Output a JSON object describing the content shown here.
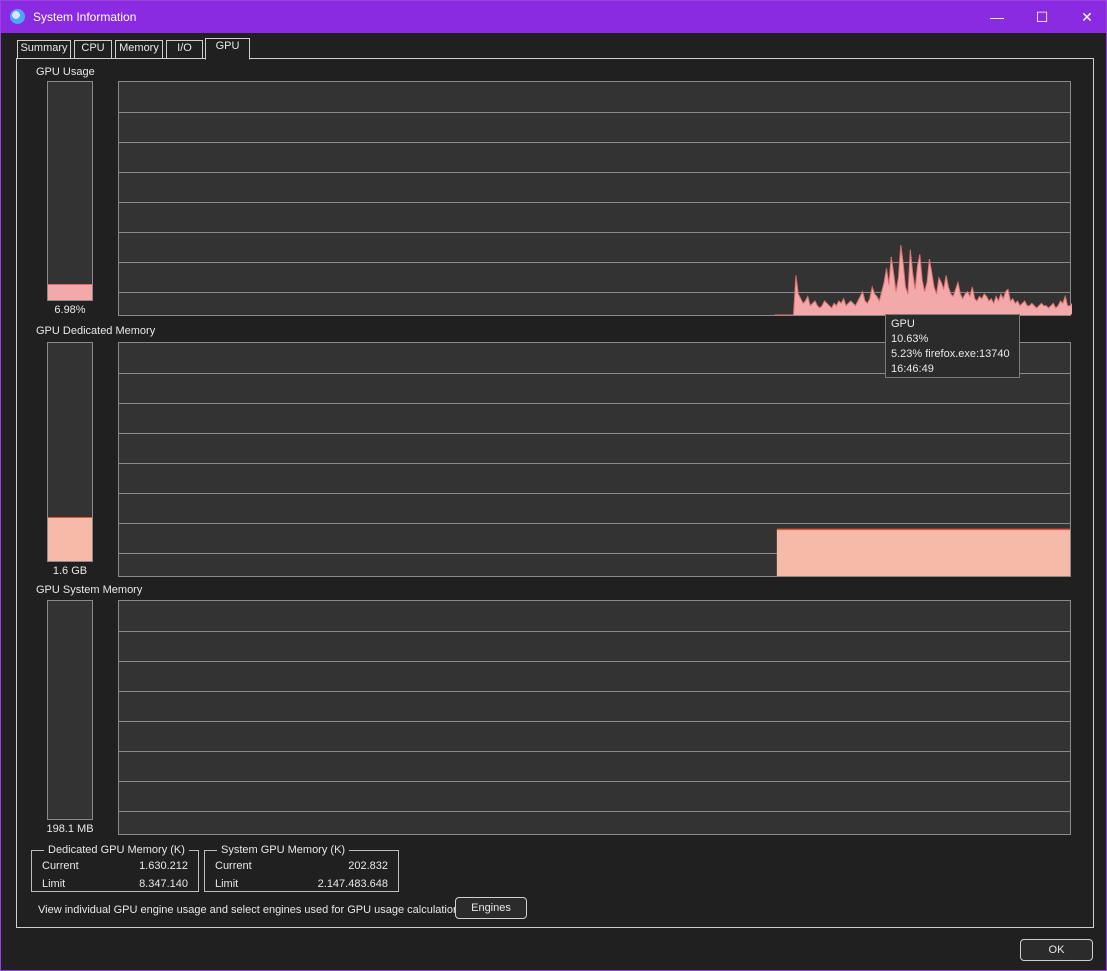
{
  "window": {
    "title": "System Information"
  },
  "tabs": [
    {
      "label": "Summary"
    },
    {
      "label": "CPU"
    },
    {
      "label": "Memory"
    },
    {
      "label": "I/O"
    },
    {
      "label": "GPU"
    }
  ],
  "sections": {
    "usage": {
      "label": "GPU Usage",
      "meter_value": "6.98%",
      "meter_fraction": 0.07
    },
    "dedicated": {
      "label": "GPU Dedicated Memory",
      "meter_value": "1.6 GB",
      "meter_fraction": 0.195
    },
    "system": {
      "label": "GPU System Memory",
      "meter_value": "198.1 MB",
      "meter_fraction": 0.0
    }
  },
  "tooltip": {
    "line1": "GPU",
    "line2": "10.63%",
    "line3": "5.23% firefox.exe:13740",
    "line4": "16:46:49"
  },
  "dedicated_box": {
    "title": "Dedicated GPU Memory (K)",
    "current_label": "Current",
    "current_value": "1.630.212",
    "limit_label": "Limit",
    "limit_value": "8.347.140"
  },
  "system_box": {
    "title": "System GPU Memory (K)",
    "current_label": "Current",
    "current_value": "202.832",
    "limit_label": "Limit",
    "limit_value": "2.147.483.648"
  },
  "hint": "View individual GPU engine usage and select engines used for GPU usage calculations:",
  "buttons": {
    "engines": "Engines",
    "ok": "OK"
  },
  "colors": {
    "accent": "#8a2be2",
    "usage_fill": "#f3a9a9",
    "memory_fill": "#f5bba8",
    "memory_line": "#e8553a"
  },
  "chart_data": [
    {
      "type": "area",
      "name": "GPU Usage",
      "ylim": [
        0,
        100
      ],
      "grid": true,
      "x_samples": 400,
      "history_start_index": 275,
      "values": [
        0,
        0,
        0,
        0,
        0,
        0,
        0,
        0,
        0,
        0,
        0,
        0,
        0,
        0,
        0,
        0,
        0,
        0,
        0,
        0,
        0,
        0,
        0,
        0,
        0,
        0,
        0,
        0,
        0,
        0,
        0,
        0,
        0,
        0,
        0,
        0,
        0,
        0,
        0,
        0,
        0,
        0,
        0,
        0,
        0,
        0,
        0,
        0,
        0,
        0,
        0,
        0,
        0,
        0,
        0,
        0,
        0,
        0,
        0,
        0,
        0,
        0,
        0,
        0,
        0,
        0,
        0,
        0,
        0,
        0,
        0,
        0,
        0,
        0,
        0,
        0,
        0,
        0,
        0,
        0,
        0,
        0,
        0,
        0,
        0,
        0,
        0,
        0,
        0,
        0,
        0,
        0,
        0,
        0,
        0,
        0,
        0,
        0,
        0,
        0,
        0,
        0,
        0,
        0,
        0,
        0,
        0,
        0,
        0,
        0,
        0,
        0,
        0,
        0,
        0,
        0,
        0,
        0,
        0,
        0,
        0,
        0,
        0,
        0,
        0,
        0,
        0,
        0,
        0,
        0,
        0,
        0,
        0,
        0,
        0,
        0,
        0,
        0,
        0,
        0,
        0,
        0,
        0,
        0,
        0,
        0,
        0,
        0,
        0,
        0,
        0,
        0,
        0,
        0,
        0,
        0,
        0,
        0,
        0,
        0,
        0,
        0,
        0,
        0,
        0,
        0,
        0,
        0,
        0,
        0,
        0,
        0,
        0,
        0,
        0,
        0,
        0,
        0,
        0,
        0,
        0,
        0,
        0,
        0,
        0,
        0,
        0,
        0,
        0,
        0,
        0,
        0,
        0,
        0,
        0,
        0,
        0,
        0,
        0,
        0,
        0,
        0,
        0,
        0,
        0,
        0,
        0,
        0,
        0,
        0,
        0,
        0,
        0,
        0,
        0,
        0,
        0,
        0,
        0,
        0,
        0,
        0,
        0,
        0,
        0,
        0,
        0,
        0,
        0,
        0,
        0,
        0,
        0,
        0,
        0,
        0,
        0,
        0,
        0,
        0,
        0,
        0,
        0,
        0,
        0,
        0,
        0,
        0,
        0,
        0,
        0,
        0,
        0,
        0,
        0,
        0,
        0,
        0,
        0,
        0,
        0,
        0,
        0,
        0,
        0,
        0,
        0,
        0,
        0,
        0,
        0,
        0,
        0,
        0,
        0,
        0,
        0,
        0,
        0,
        0,
        0,
        0,
        0,
        0,
        17,
        9,
        7,
        5,
        6,
        8,
        4,
        5,
        6,
        4,
        3,
        4,
        6,
        5,
        4,
        3,
        5,
        4,
        6,
        5,
        7,
        4,
        5,
        6,
        5,
        4,
        6,
        8,
        10,
        6,
        5,
        7,
        12,
        9,
        8,
        6,
        10,
        14,
        20,
        13,
        25,
        18,
        10,
        16,
        30,
        22,
        12,
        9,
        28,
        18,
        11,
        21,
        26,
        15,
        10,
        14,
        24,
        18,
        12,
        9,
        16,
        14,
        11,
        17,
        12,
        9,
        8,
        11,
        14,
        9,
        7,
        9,
        10,
        8,
        12,
        7,
        6,
        8,
        7,
        9,
        8,
        6,
        7,
        5,
        8,
        6,
        9,
        7,
        10,
        11,
        6,
        7,
        5,
        6,
        4,
        5,
        6,
        4,
        4,
        5,
        4,
        3,
        4,
        5,
        4,
        4,
        3,
        4,
        5,
        3,
        4,
        6,
        5,
        8,
        4,
        4,
        5,
        3,
        4,
        5,
        4,
        3,
        6,
        5,
        4,
        5
      ]
    },
    {
      "type": "area",
      "name": "GPU Dedicated Memory",
      "ylim": [
        0,
        8.0
      ],
      "grid": true,
      "x_samples": 400,
      "history_start_index": 276,
      "constant_value": 1.6
    },
    {
      "type": "area",
      "name": "GPU System Memory",
      "ylim": [
        0,
        2048
      ],
      "grid": true,
      "x_samples": 400,
      "constant_value": 0.2
    }
  ]
}
